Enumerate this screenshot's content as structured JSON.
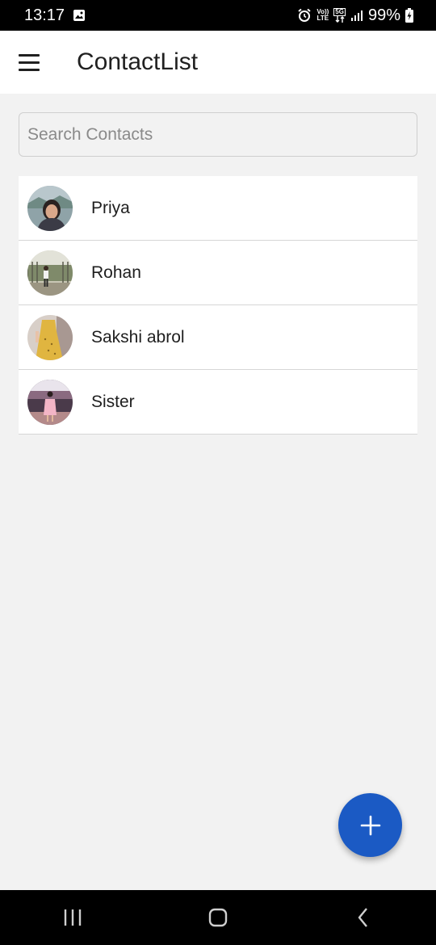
{
  "status_bar": {
    "time": "13:17",
    "network_top": "Vo))",
    "network_bottom": "LTE",
    "five_g_top": "5G",
    "battery": "99%"
  },
  "app_bar": {
    "title": "ContactList"
  },
  "search": {
    "placeholder": "Search Contacts",
    "value": ""
  },
  "contacts": [
    {
      "name": "Priya"
    },
    {
      "name": "Rohan"
    },
    {
      "name": "Sakshi abrol"
    },
    {
      "name": "Sister"
    }
  ],
  "colors": {
    "accent": "#1b5ac4",
    "background": "#f2f2f2",
    "surface": "#ffffff"
  }
}
